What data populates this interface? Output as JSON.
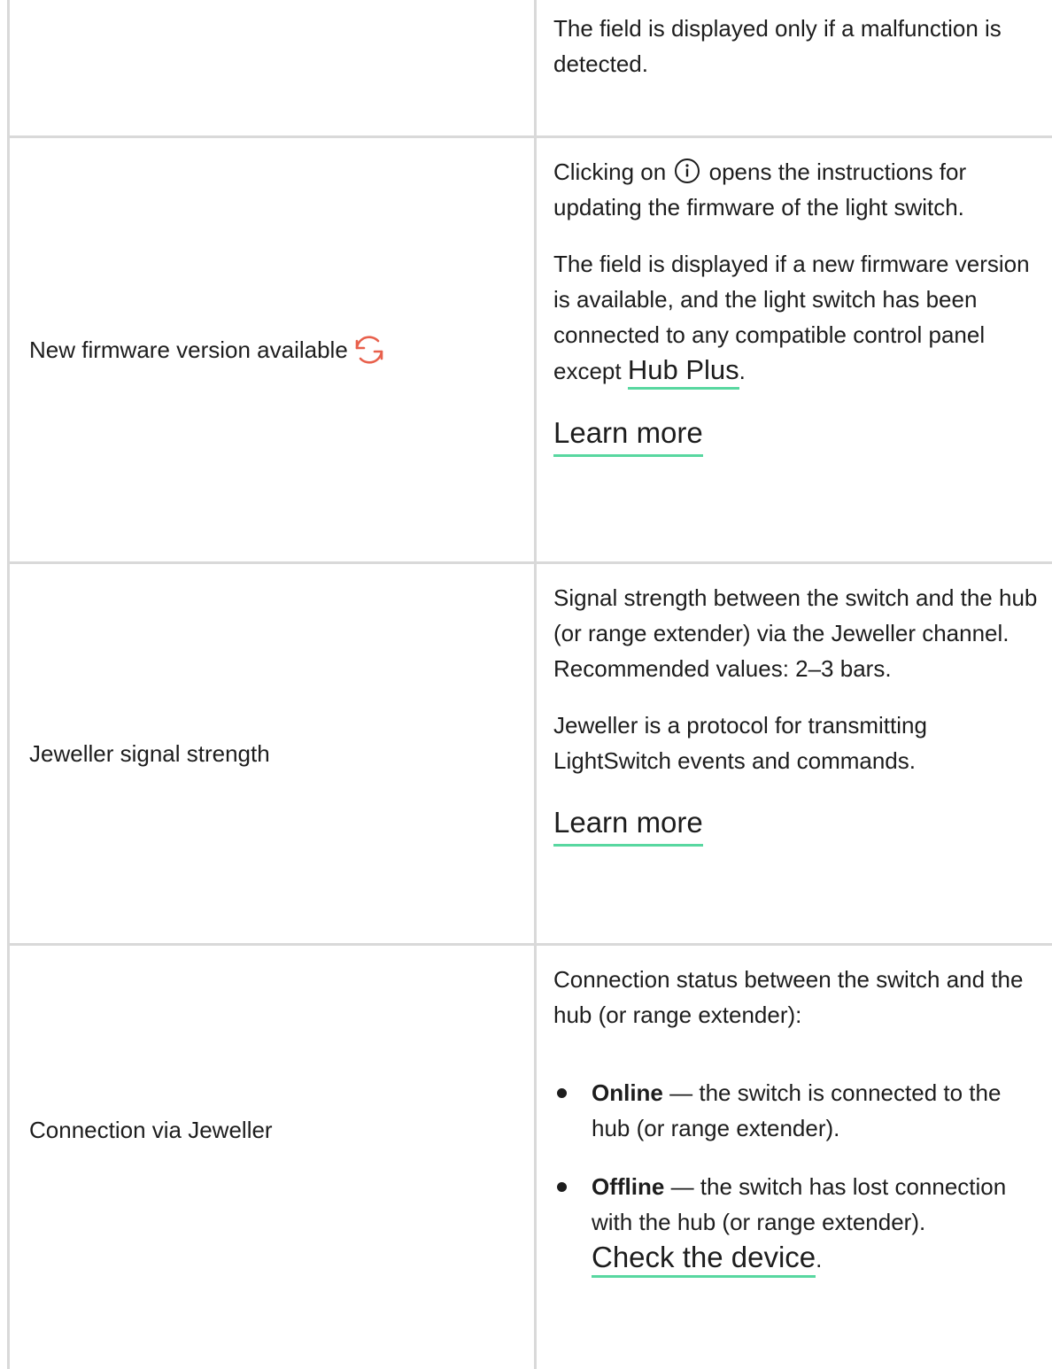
{
  "rows": [
    {
      "left": "",
      "right": [
        "The field is displayed only if a malfunction is detected."
      ]
    },
    {
      "left": "New firmware version available",
      "left_icon": "sync-arrows-icon",
      "right_p1_before": "Clicking on",
      "right_p1_icon": "info-icon",
      "right_p1_after": "opens the instructions for updating the firmware of the light switch.",
      "right_p2_before": "The field is displayed if a new firmware version is available, and the light switch has been connected to any compatible control panel except",
      "right_p2_link": "Hub Plus",
      "right_p2_after": ".",
      "learn_more": "Learn more"
    },
    {
      "left": "Jeweller signal strength",
      "right_p1": "Signal strength between the switch and the hub (or range extender) via the Jeweller channel. Recommended values: 2–3 bars.",
      "right_p2": "Jeweller is a protocol for transmitting LightSwitch events and commands.",
      "learn_more": "Learn more"
    },
    {
      "left": "Connection via Jeweller",
      "right_p1": "Connection status between the switch and the hub (or range extender):",
      "items": [
        {
          "term": "Online",
          "text": " — the switch is connected to the hub (or range extender)."
        },
        {
          "term": "Offline",
          "text": " — the switch has lost connection with the hub (or range extender).",
          "link": "Check the device",
          "after": "."
        }
      ]
    }
  ],
  "colors": {
    "border": "#d9d9d9",
    "link_underline": "#58d7a0",
    "sync_icon": "#e8604c",
    "text": "#1d1d1d"
  }
}
